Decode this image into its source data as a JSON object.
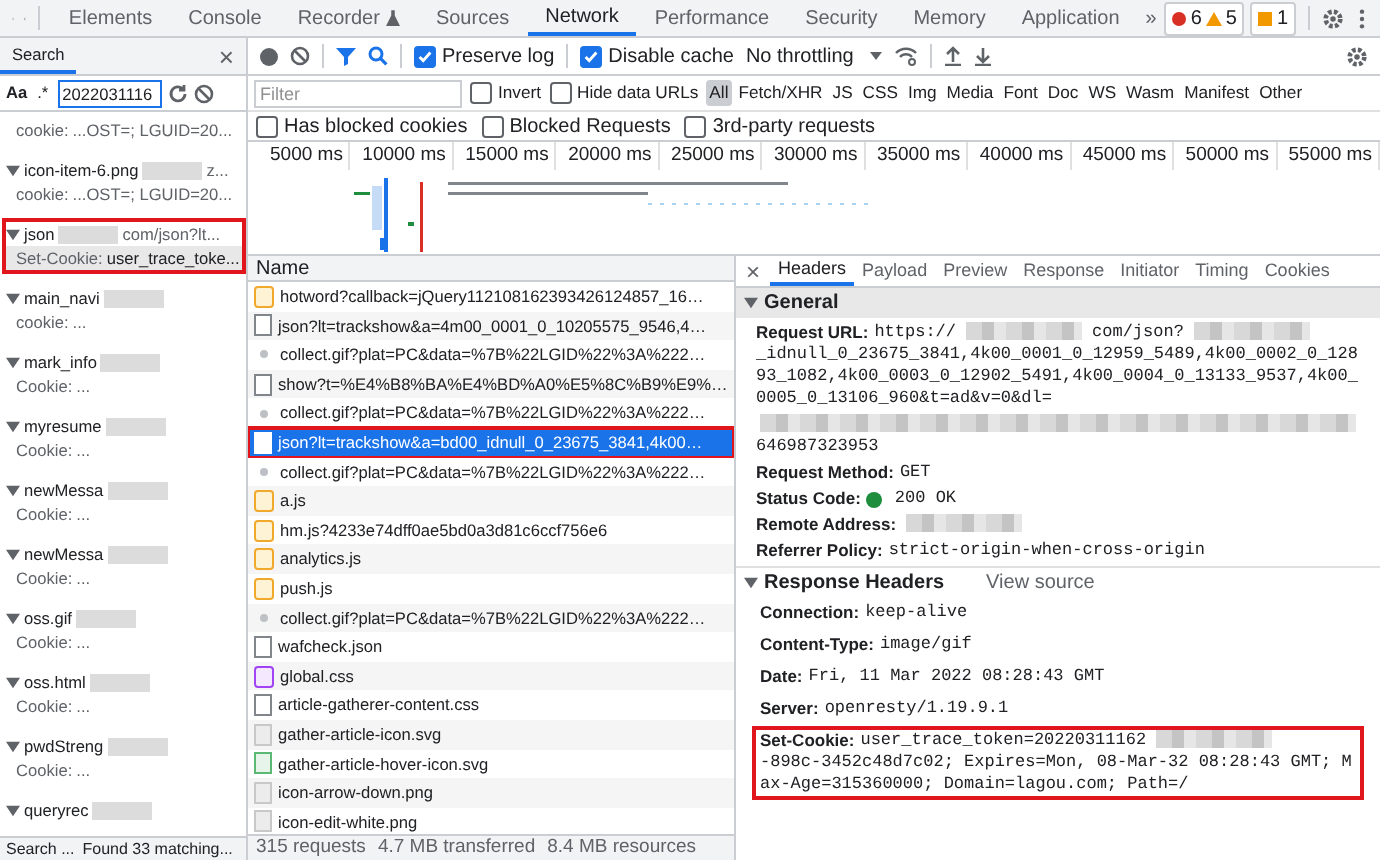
{
  "main_tabs": [
    {
      "label": "Elements",
      "selected": false
    },
    {
      "label": "Console",
      "selected": false
    },
    {
      "label": "Recorder",
      "selected": false,
      "kind": "flask"
    },
    {
      "label": "Sources",
      "selected": false
    },
    {
      "label": "Network",
      "selected": true
    },
    {
      "label": "Performance",
      "selected": false
    },
    {
      "label": "Security",
      "selected": false
    },
    {
      "label": "Memory",
      "selected": false
    },
    {
      "label": "Application",
      "selected": false
    }
  ],
  "more_tabs": "»",
  "badges": {
    "errors": "6",
    "warnings": "5",
    "issues": "1"
  },
  "search_panel": {
    "title": "Search",
    "close": "×",
    "case_label": "Aa",
    "regex_label": ".*",
    "query": "2022031116",
    "results": [
      {
        "highlighted": false,
        "line_label": "cookie:",
        "line_value": "...OST=; LGUID=20..."
      },
      {
        "file": "icon-item-6.png",
        "url_tail": "z...",
        "highlighted": false,
        "line_label": "cookie:",
        "line_value": "...OST=; LGUID=20..."
      },
      {
        "file": "json",
        "url_tail": "com/json?lt...",
        "highlighted": true,
        "line_label": "Set-Cookie:",
        "line_value": "user_trace_toke..."
      },
      {
        "file": "main_navi",
        "highlighted": false,
        "line_label": "cookie:",
        "line_value": "..."
      },
      {
        "file": "mark_info",
        "highlighted": false,
        "line_label": "Cookie:",
        "line_value": "..."
      },
      {
        "file": "myresume",
        "highlighted": false,
        "line_label": "Cookie:",
        "line_value": "..."
      },
      {
        "file": "newMessa",
        "highlighted": false,
        "line_label": "Cookie:",
        "line_value": "..."
      },
      {
        "file": "newMessa",
        "highlighted": false,
        "line_label": "Cookie:",
        "line_value": "..."
      },
      {
        "file": "oss.gif",
        "highlighted": false,
        "line_label": "Cookie:",
        "line_value": "..."
      },
      {
        "file": "oss.html",
        "highlighted": false,
        "line_label": "Cookie:",
        "line_value": "..."
      },
      {
        "file": "pwdStreng",
        "highlighted": false,
        "line_label": "Cookie:",
        "line_value": "..."
      },
      {
        "file": "queryrec",
        "highlighted": false
      }
    ],
    "status_left": "Search ...",
    "status_right": "Found 33 matching..."
  },
  "toolbar": {
    "preserve_log": {
      "label": "Preserve log",
      "checked": true
    },
    "disable_cache": {
      "label": "Disable cache",
      "checked": true
    },
    "throttling": "No throttling"
  },
  "filter": {
    "placeholder": "Filter",
    "invert": {
      "label": "Invert",
      "checked": false
    },
    "hide_data_urls": {
      "label": "Hide data URLs",
      "checked": false
    },
    "types": [
      {
        "label": "All",
        "selected": true
      },
      {
        "label": "Fetch/XHR",
        "selected": false
      },
      {
        "label": "JS",
        "selected": false
      },
      {
        "label": "CSS",
        "selected": false
      },
      {
        "label": "Img",
        "selected": false
      },
      {
        "label": "Media",
        "selected": false
      },
      {
        "label": "Font",
        "selected": false
      },
      {
        "label": "Doc",
        "selected": false
      },
      {
        "label": "WS",
        "selected": false
      },
      {
        "label": "Wasm",
        "selected": false
      },
      {
        "label": "Manifest",
        "selected": false
      },
      {
        "label": "Other",
        "selected": false
      }
    ],
    "options": [
      {
        "label": "Has blocked cookies",
        "checked": false
      },
      {
        "label": "Blocked Requests",
        "checked": false
      },
      {
        "label": "3rd-party requests",
        "checked": false
      }
    ]
  },
  "timeline_ticks": [
    "5000 ms",
    "10000 ms",
    "15000 ms",
    "20000 ms",
    "25000 ms",
    "30000 ms",
    "35000 ms",
    "40000 ms",
    "45000 ms",
    "50000 ms",
    "55000 ms"
  ],
  "requests": {
    "column": "Name",
    "rows": [
      {
        "name": "hotword?callback=jQuery112108162393426124857_16…",
        "kind": "script",
        "selected": false,
        "highlighted": false
      },
      {
        "name": "json?lt=trackshow&a=4m00_0001_0_10205575_9546,4…",
        "kind": "doc",
        "selected": false,
        "highlighted": false
      },
      {
        "name": "collect.gif?plat=PC&data=%7B%22LGID%22%3A%222…",
        "kind": "dot",
        "selected": false,
        "highlighted": false
      },
      {
        "name": "show?t=%E4%B8%BA%E4%BD%A0%E5%8C%B9%E9%…",
        "kind": "doc",
        "selected": false,
        "highlighted": false
      },
      {
        "name": "collect.gif?plat=PC&data=%7B%22LGID%22%3A%222…",
        "kind": "dot",
        "selected": false,
        "highlighted": false
      },
      {
        "name": "json?lt=trackshow&a=bd00_idnull_0_23675_3841,4k00…",
        "kind": "doc",
        "selected": true,
        "highlighted": true
      },
      {
        "name": "collect.gif?plat=PC&data=%7B%22LGID%22%3A%222…",
        "kind": "dot",
        "selected": false,
        "highlighted": false
      },
      {
        "name": "a.js",
        "kind": "script",
        "selected": false,
        "highlighted": false
      },
      {
        "name": "hm.js?4233e74dff0ae5bd0a3d81c6ccf756e6",
        "kind": "script",
        "selected": false,
        "highlighted": false
      },
      {
        "name": "analytics.js",
        "kind": "script",
        "selected": false,
        "highlighted": false
      },
      {
        "name": "push.js",
        "kind": "script",
        "selected": false,
        "highlighted": false
      },
      {
        "name": "collect.gif?plat=PC&data=%7B%22LGID%22%3A%222…",
        "kind": "dot",
        "selected": false,
        "highlighted": false
      },
      {
        "name": "wafcheck.json",
        "kind": "doc",
        "selected": false,
        "highlighted": false
      },
      {
        "name": "global.css",
        "kind": "css",
        "selected": false,
        "highlighted": false
      },
      {
        "name": "article-gatherer-content.css",
        "kind": "doc",
        "selected": false,
        "highlighted": false
      },
      {
        "name": "gather-article-icon.svg",
        "kind": "image",
        "selected": false,
        "highlighted": false
      },
      {
        "name": "gather-article-hover-icon.svg",
        "kind": "image-green",
        "selected": false,
        "highlighted": false
      },
      {
        "name": "icon-arrow-down.png",
        "kind": "image",
        "selected": false,
        "highlighted": false
      },
      {
        "name": "icon-edit-white.png",
        "kind": "image",
        "selected": false,
        "highlighted": false
      }
    ]
  },
  "summary": [
    "315 requests",
    "4.7 MB transferred",
    "8.4 MB resources"
  ],
  "details": {
    "close": "×",
    "tabs": [
      {
        "label": "Headers",
        "selected": true
      },
      {
        "label": "Payload",
        "selected": false
      },
      {
        "label": "Preview",
        "selected": false
      },
      {
        "label": "Response",
        "selected": false
      },
      {
        "label": "Initiator",
        "selected": false
      },
      {
        "label": "Timing",
        "selected": false
      },
      {
        "label": "Cookies",
        "selected": false
      }
    ],
    "general": {
      "title": "General",
      "expanded": true,
      "rows": [
        {
          "label": "Request URL:",
          "parts": [
            {
              "kind": "text",
              "text": "https://"
            },
            {
              "kind": "redacted"
            },
            {
              "kind": "text",
              "text": "com/json?"
            },
            {
              "kind": "redacted"
            },
            {
              "kind": "text",
              "text": "_idnull_0_23675_3841,4k00_0001_0_12959_5489,4k00_0002_0_12893_1082,4k00_0003_0_12902_5491,4k00_0004_0_13133_9537,4k00_0005_0_13106_960&t=ad&v=0&dl="
            },
            {
              "kind": "redacted_line"
            },
            {
              "kind": "text",
              "text": "646987323953"
            }
          ]
        },
        {
          "label": "Request Method:",
          "parts": [
            {
              "kind": "text",
              "text": "GET"
            }
          ]
        },
        {
          "label": "Status Code:",
          "parts": [
            {
              "kind": "status_dot",
              "color": "#1e8e3e"
            },
            {
              "kind": "text",
              "text": "200 OK"
            }
          ]
        },
        {
          "label": "Remote Address:",
          "parts": [
            {
              "kind": "redacted"
            }
          ]
        },
        {
          "label": "Referrer Policy:",
          "parts": [
            {
              "kind": "text",
              "text": "strict-origin-when-cross-origin"
            }
          ]
        }
      ]
    },
    "response_headers": {
      "title": "Response Headers",
      "expanded": true,
      "view_source": "View source",
      "rows": [
        {
          "label": "Connection:",
          "highlighted": false,
          "parts": [
            {
              "kind": "text",
              "text": "keep-alive"
            }
          ]
        },
        {
          "label": "Content-Type:",
          "highlighted": false,
          "parts": [
            {
              "kind": "text",
              "text": "image/gif"
            }
          ]
        },
        {
          "label": "Date:",
          "highlighted": false,
          "parts": [
            {
              "kind": "text",
              "text": "Fri, 11 Mar 2022 08:28:43 GMT"
            }
          ]
        },
        {
          "label": "Server:",
          "highlighted": false,
          "parts": [
            {
              "kind": "text",
              "text": "openresty/1.19.9.1"
            }
          ]
        },
        {
          "label": "Set-Cookie:",
          "highlighted": true,
          "parts": [
            {
              "kind": "text",
              "text": "user_trace_token=20220311162"
            },
            {
              "kind": "redacted"
            },
            {
              "kind": "text",
              "text": "-898c-3452c48d7c02; Expires=Mon, 08-Mar-32 08:28:43 GMT; Max-Age=315360000; Domain=lagou.com; Path=/"
            }
          ]
        }
      ]
    }
  }
}
